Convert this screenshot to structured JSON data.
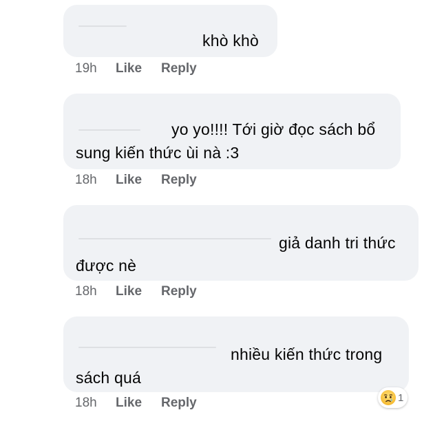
{
  "comments": [
    {
      "lines": [
        "khò khò"
      ],
      "time": "19h",
      "like": "Like",
      "reply": "Reply"
    },
    {
      "lines": [
        "yo yo!!!! Tới giờ đọc sách bổ",
        "sung kiến thức ùi nà :3"
      ],
      "time": "18h",
      "like": "Like",
      "reply": "Reply"
    },
    {
      "lines": [
        "giả danh tri thức",
        "được nè"
      ],
      "time": "18h",
      "like": "Like",
      "reply": "Reply"
    },
    {
      "lines": [
        "nhiều kiến thức trong",
        "sách quá"
      ],
      "time": "18h",
      "like": "Like",
      "reply": "Reply"
    }
  ],
  "reaction": {
    "icon": "sad-face-icon",
    "count": "1"
  },
  "colors": {
    "bubble": "#f0f2f5",
    "text": "#050505",
    "meta": "#65676b"
  }
}
